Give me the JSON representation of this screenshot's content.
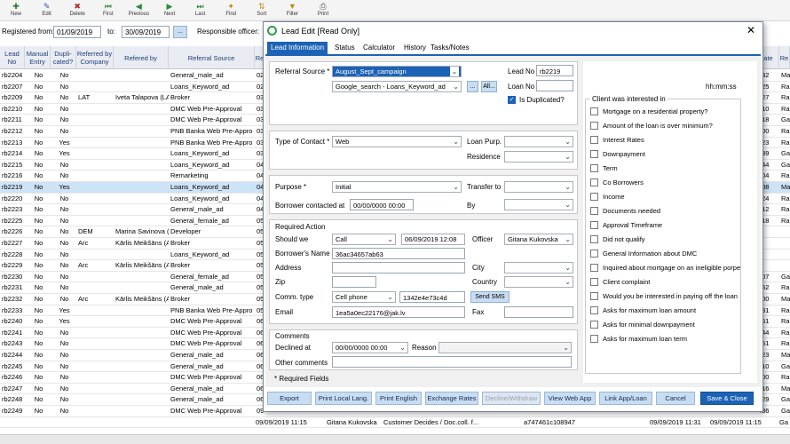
{
  "toolbar": [
    {
      "label": "New",
      "icon": "new-icon",
      "glyph": "✚",
      "color": "#2a7a2a"
    },
    {
      "label": "Edit",
      "icon": "edit-icon",
      "glyph": "✎",
      "color": "#2c5aa0"
    },
    {
      "label": "Delete",
      "icon": "delete-icon",
      "glyph": "✖",
      "color": "#b03030"
    },
    {
      "label": "First",
      "icon": "first-icon",
      "glyph": "⏮",
      "color": "#2a8a3a"
    },
    {
      "label": "Previous",
      "icon": "previous-icon",
      "glyph": "◀",
      "color": "#2a8a3a"
    },
    {
      "label": "Next",
      "icon": "next-icon",
      "glyph": "▶",
      "color": "#2a8a3a"
    },
    {
      "label": "Last",
      "icon": "last-icon",
      "glyph": "⏭",
      "color": "#2a8a3a"
    },
    {
      "label": "Find",
      "icon": "find-icon",
      "glyph": "✦",
      "color": "#c08a00"
    },
    {
      "label": "Sort",
      "icon": "sort-icon",
      "glyph": "⇅",
      "color": "#c08a00"
    },
    {
      "label": "Filter",
      "icon": "filter-icon",
      "glyph": "▼",
      "color": "#c08a00"
    },
    {
      "label": "Print",
      "icon": "print-icon",
      "glyph": "⎙",
      "color": "#555555"
    }
  ],
  "filter": {
    "registered_from_label": "Registered from:",
    "from_date": "01/09/2019",
    "to_label": "to:",
    "to_date": "30/09/2019",
    "ellipsis": "...",
    "responsible_label": "Responsible officer:"
  },
  "grid": {
    "headers": [
      "Lead No",
      "Manual Entry",
      "Dupli-cated?",
      "Referred by Company",
      "Refered by",
      "Referral Source",
      "Re",
      "ate",
      "Re"
    ],
    "rows": [
      [
        "rb2204",
        "No",
        "No",
        "",
        "",
        "General_male_ad",
        "02",
        ":32",
        "Ma"
      ],
      [
        "rb2207",
        "No",
        "No",
        "",
        "",
        "Loans_Keyword_ad",
        "02",
        ":25",
        "Ra"
      ],
      [
        "rb2209",
        "No",
        "No",
        "LAT",
        "Iveta Talapova (LA",
        "Broker",
        "03",
        ":27",
        "Ra"
      ],
      [
        "rb2210",
        "No",
        "No",
        "",
        "",
        "DMC Web Pre-Approval",
        "03",
        ":10",
        "Ra"
      ],
      [
        "rb2211",
        "No",
        "No",
        "",
        "",
        "DMC Web Pre-Approval",
        "03",
        ":18",
        "Ga"
      ],
      [
        "rb2212",
        "No",
        "No",
        "",
        "",
        "PNB Banka Web Pre-Appro",
        "03",
        ":00",
        "Ra"
      ],
      [
        "rb2213",
        "No",
        "Yes",
        "",
        "",
        "PNB Banka Web Pre-Appro",
        "03",
        ":23",
        "Ra"
      ],
      [
        "rb2214",
        "No",
        "Yes",
        "",
        "",
        "Loans_Keyword_ad",
        "03",
        ":39",
        "Ga"
      ],
      [
        "rb2215",
        "No",
        "No",
        "",
        "",
        "Loans_Keyword_ad",
        "04",
        ":44",
        "Ga"
      ],
      [
        "rb2216",
        "No",
        "No",
        "",
        "",
        "Remarketing",
        "04",
        ":04",
        "Ra"
      ],
      [
        "rb2219",
        "No",
        "Yes",
        "",
        "",
        "Loans_Keyword_ad",
        "04",
        ":08",
        "Ma"
      ],
      [
        "rb2220",
        "No",
        "No",
        "",
        "",
        "Loans_Keyword_ad",
        "04",
        ":24",
        "Ra"
      ],
      [
        "rb2223",
        "No",
        "No",
        "",
        "",
        "General_male_ad",
        "04",
        ":12",
        "Ra"
      ],
      [
        "rb2225",
        "No",
        "No",
        "",
        "",
        "General_female_ad",
        "05",
        ":18",
        "Ra"
      ],
      [
        "rb2226",
        "No",
        "No",
        "DEM",
        "Marina Savinova (",
        "Developer",
        "05",
        "",
        ""
      ],
      [
        "rb2227",
        "No",
        "No",
        "Arc",
        "Kārlis Meikšāns (A",
        "Broker",
        "05",
        "",
        ""
      ],
      [
        "rb2228",
        "No",
        "No",
        "",
        "",
        "Loans_Keyword_ad",
        "05",
        "",
        ""
      ],
      [
        "rb2229",
        "No",
        "No",
        "Arc",
        "Kārlis Meikšāns (A",
        "Broker",
        "05",
        "",
        ""
      ],
      [
        "rb2230",
        "No",
        "No",
        "",
        "",
        "General_female_ad",
        "05",
        ":07",
        "Ga"
      ],
      [
        "rb2231",
        "No",
        "No",
        "",
        "",
        "General_male_ad",
        "05",
        ":52",
        "Ra"
      ],
      [
        "rb2232",
        "No",
        "No",
        "Arc",
        "Kārlis Meikšāns (A",
        "Broker",
        "05",
        ":00",
        "Ma"
      ],
      [
        "rb2233",
        "No",
        "Yes",
        "",
        "",
        "PNB Banka Web Pre-Appro",
        "05",
        ":31",
        "Ra"
      ],
      [
        "rb2240",
        "No",
        "Yes",
        "",
        "",
        "DMC Web Pre-Approval",
        "06",
        ":51",
        "Ra"
      ],
      [
        "rb2241",
        "No",
        "No",
        "",
        "",
        "DMC Web Pre-Approval",
        "06",
        ":44",
        "Ra"
      ],
      [
        "rb2243",
        "No",
        "No",
        "",
        "",
        "DMC Web Pre-Approval",
        "06",
        ":51",
        "Ra"
      ],
      [
        "rb2244",
        "No",
        "No",
        "",
        "",
        "General_male_ad",
        "06",
        ":23",
        "Ma"
      ],
      [
        "rb2245",
        "No",
        "No",
        "",
        "",
        "General_male_ad",
        "06",
        ":10",
        "Ga"
      ],
      [
        "rb2246",
        "No",
        "No",
        "",
        "",
        "DMC Web Pre-Approval",
        "06",
        ":00",
        "Ra"
      ],
      [
        "rb2247",
        "No",
        "No",
        "",
        "",
        "General_male_ad",
        "06",
        ":16",
        "Ma"
      ],
      [
        "rb2248",
        "No",
        "No",
        "",
        "",
        "General_male_ad",
        "06",
        ":29",
        "Ga"
      ],
      [
        "rb2249",
        "No",
        "No",
        "",
        "",
        "DMC Web Pre-Approval",
        "09",
        ":36",
        "Ga"
      ]
    ],
    "footer_row": [
      "09/09/2019 11:15",
      "Gitana Kukovska",
      "Customer Decides / Doc.coll. f...",
      "a747461c108947",
      "09/09/2019 11:31",
      "09/09/2019 11:15",
      "Ga"
    ]
  },
  "dialog": {
    "title": "Lead Edit [Read Only]",
    "tabs": [
      "Lead Information",
      "Status",
      "Calculator",
      "History",
      "Tasks/Notes"
    ],
    "referral_source_label": "Referral Source *",
    "referral_source_value": "August_Sept_campaign",
    "referral_sub_value": "Google_search - Loans_Keyword_ad",
    "dots_btn": "...",
    "all_btn": "All...",
    "lead_no_label": "Lead No",
    "lead_no_value": "rb2219",
    "loan_no_label": "Loan No",
    "loan_no_value": "",
    "is_duplicated_label": "Is Duplicated?",
    "hhmmss": "hh:mm:ss",
    "type_of_contact_label": "Type of Contact *",
    "type_of_contact_value": "Web",
    "loan_purp_label": "Loan Purp.",
    "residence_label": "Residence",
    "purpose_label": "Purpose *",
    "purpose_value": "Initial",
    "transfer_to_label": "Transfer to",
    "borrower_contacted_label": "Borrower contacted at",
    "borrower_contacted_value": "00/00/0000 00:00",
    "by_label": "By",
    "required_action_title": "Required Action",
    "should_we_label": "Should we",
    "should_we_value": "Call",
    "action_datetime": "06/09/2019 12:08",
    "officer_label": "Officer",
    "officer_value": "Gitana Kukovska",
    "borrowers_name_label": "Borrower's Name",
    "borrowers_name_value": "36ac34657ab63",
    "address_label": "Address",
    "city_label": "City",
    "zip_label": "Zip",
    "country_label": "Country",
    "comm_type_label": "Comm. type",
    "comm_type_value": "Cell phone",
    "phone_value": "1342e4e73c4d",
    "send_sms_btn": "Send SMS",
    "email_label": "Email",
    "email_value": "1ea5a0ec22176@jak.lv",
    "fax_label": "Fax",
    "comments_title": "Comments",
    "declined_at_label": "Declined at",
    "declined_at_value": "00/00/0000 00:00",
    "reason_label": "Reason",
    "other_comments_label": "Other comments",
    "required_fields_note": "* Required Fields",
    "client_interest_title": "Client was interested in",
    "interests": [
      "Mortgage on a residential property?",
      "Amount of the loan is over minimum?",
      "Interest Rates",
      "Downpayment",
      "Term",
      "Co Borrowers",
      "Income",
      "Documents needed",
      "Approval Timeframe",
      "Did not qualify",
      "General Information about DMC",
      "Inquired about mortgage on an ineligible porpe",
      "Client complaint",
      "Would you be interested in paying off the loan",
      "Asks for maximum loan amount",
      "Asks for minimal downpayment",
      "Asks for maximum loan term"
    ],
    "buttons": [
      "Export",
      "Print Local Lang.",
      "Print English",
      "Exchange Rates",
      "Decline/Withdraw",
      "View Web App",
      "Link App/Loan",
      "Cancel",
      "Save & Close"
    ]
  },
  "colors": {
    "accent": "#1c63b5",
    "selected_row": "#cde3f7"
  }
}
